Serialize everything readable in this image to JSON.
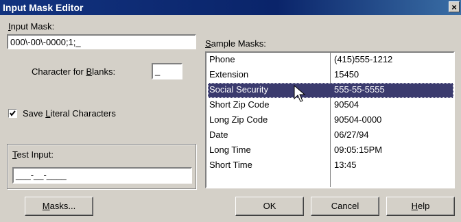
{
  "window": {
    "title": "Input Mask Editor",
    "close_label": "×"
  },
  "input_mask": {
    "label_u": "I",
    "label_rest": "nput Mask:",
    "value": "000\\-00\\-0000;1;_"
  },
  "blanks": {
    "label_pre": "Character for ",
    "label_u": "B",
    "label_rest": "lanks:",
    "value": "_"
  },
  "save_literal": {
    "label_pre": "Save ",
    "label_u": "L",
    "label_rest": "iteral Characters",
    "checked": true
  },
  "test_input": {
    "label_u": "T",
    "label_rest": "est Input:",
    "value": "___-__-____"
  },
  "sample_masks": {
    "label_u": "S",
    "label_rest": "ample Masks:",
    "rows": [
      {
        "name": "Phone",
        "sample": "(415)555-1212",
        "selected": false
      },
      {
        "name": "Extension",
        "sample": "15450",
        "selected": false
      },
      {
        "name": "Social Security",
        "sample": "555-55-5555",
        "selected": true
      },
      {
        "name": "Short Zip Code",
        "sample": "90504",
        "selected": false
      },
      {
        "name": "Long Zip Code",
        "sample": "90504-0000",
        "selected": false
      },
      {
        "name": "Date",
        "sample": "06/27/94",
        "selected": false
      },
      {
        "name": "Long Time",
        "sample": "09:05:15PM",
        "selected": false
      },
      {
        "name": "Short Time",
        "sample": "13:45",
        "selected": false
      }
    ]
  },
  "buttons": {
    "masks": {
      "u": "M",
      "rest": "asks..."
    },
    "ok": "OK",
    "cancel": "Cancel",
    "help": {
      "u": "H",
      "rest": "elp"
    }
  },
  "colors": {
    "titlebar": "#0a246a",
    "selection": "#3b3b6e",
    "face": "#d4d0c8"
  }
}
